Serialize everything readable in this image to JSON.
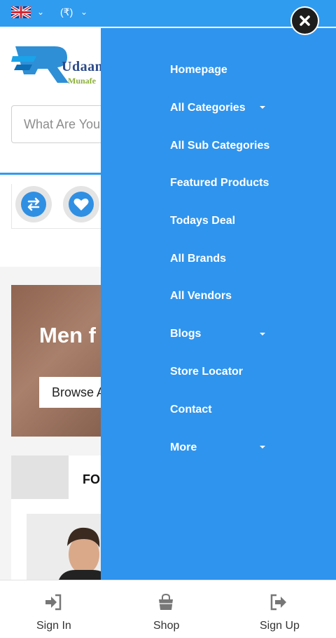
{
  "topbar": {
    "currency": "(₹)",
    "language_icon": "uk-flag-icon",
    "accent": "#2f9cf0"
  },
  "brand": {
    "name": "Udaan",
    "tagline": "Munafe"
  },
  "search": {
    "placeholder": "What Are You"
  },
  "banner": {
    "title": "Men f",
    "button": "Browse A"
  },
  "section": {
    "label": "FO"
  },
  "drawer": {
    "color": "#2f94ed",
    "items": [
      {
        "label": "Homepage",
        "has_dropdown": false
      },
      {
        "label": "All Categories",
        "has_dropdown": true
      },
      {
        "label": "All Sub Categories",
        "has_dropdown": false
      },
      {
        "label": "Featured Products",
        "has_dropdown": false
      },
      {
        "label": "Todays Deal",
        "has_dropdown": false
      },
      {
        "label": "All Brands",
        "has_dropdown": false
      },
      {
        "label": "All Vendors",
        "has_dropdown": false
      },
      {
        "label": "Blogs",
        "has_dropdown": true
      },
      {
        "label": "Store Locator",
        "has_dropdown": false
      },
      {
        "label": "Contact",
        "has_dropdown": false
      },
      {
        "label": "More",
        "has_dropdown": true
      }
    ]
  },
  "bottom_nav": {
    "items": [
      {
        "label": "Sign In",
        "icon": "sign-in-icon"
      },
      {
        "label": "Shop",
        "icon": "shopping-bag-icon"
      },
      {
        "label": "Sign Up",
        "icon": "sign-up-icon"
      }
    ]
  }
}
